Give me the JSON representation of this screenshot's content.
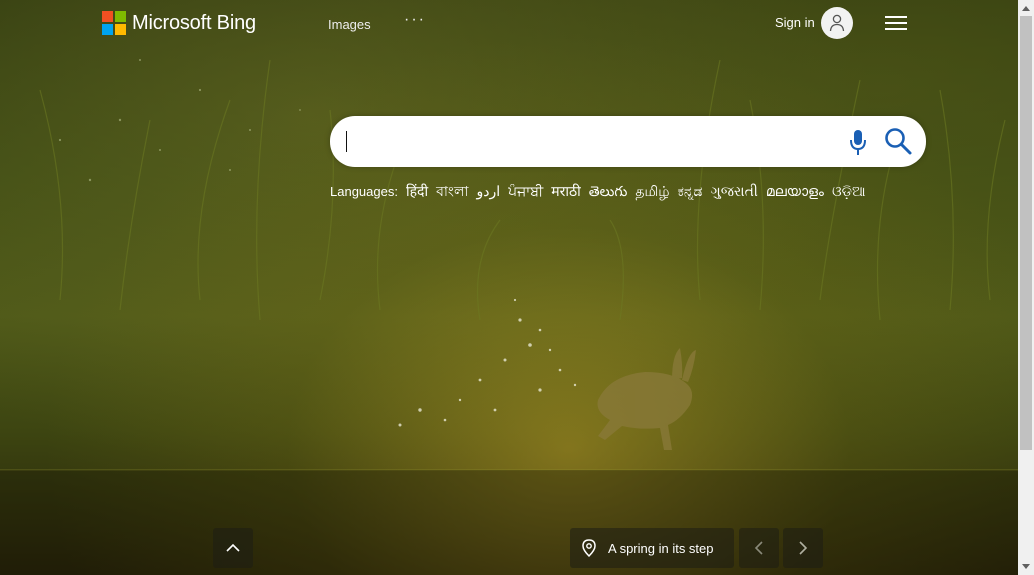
{
  "header": {
    "brand": "Microsoft Bing",
    "nav": [
      {
        "label": "Images"
      },
      {
        "label": "···"
      }
    ],
    "signin_label": "Sign in",
    "avatar_icon": "user-icon",
    "menu_icon": "hamburger-icon"
  },
  "logo_colors": [
    "#f25022",
    "#7fba00",
    "#00a4ef",
    "#ffb900"
  ],
  "search": {
    "value": "",
    "placeholder": "",
    "mic_icon": "microphone-icon",
    "search_icon": "search-icon",
    "accent": "#1a5fb4"
  },
  "languages": {
    "label": "Languages:",
    "items": [
      "हिंदी",
      "বাংলা",
      "اردو",
      "ਪੰਜਾਬੀ",
      "मराठी",
      "తెలుగు",
      "தமிழ்",
      "ಕನ್ನಡ",
      "ગુજરાતી",
      "മലയാളം",
      "ଓଡ଼ିଆ"
    ]
  },
  "footer": {
    "caption": "A spring in its step",
    "pin_icon": "location-pin-icon",
    "up_icon": "chevron-up-icon",
    "prev_icon": "chevron-left-icon",
    "next_icon": "chevron-right-icon"
  }
}
